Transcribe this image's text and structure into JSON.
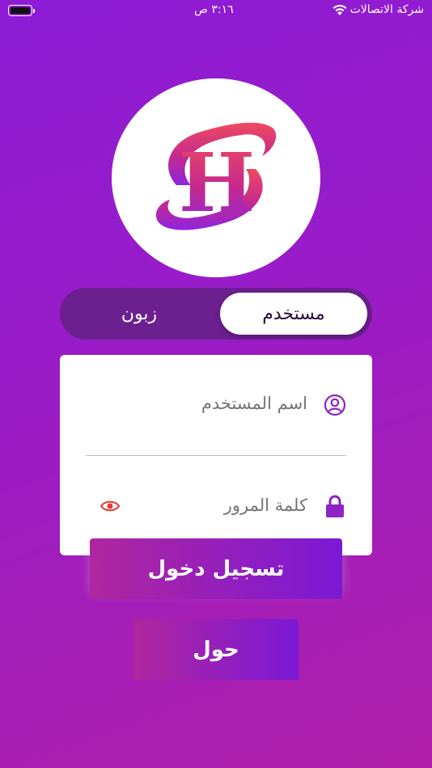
{
  "status_bar": {
    "carrier": "شركة الاتصالات",
    "time": "٣:١٦ ص"
  },
  "logo": {
    "letter_s": "S",
    "letter_h": "H"
  },
  "segment": {
    "active_label": "مستخدم",
    "inactive_label": "زبون"
  },
  "form": {
    "username_placeholder": "اسم المستخدم",
    "password_placeholder": "كلمة المرور"
  },
  "buttons": {
    "login_label": "تسجيل دخول",
    "about_label": "حول"
  },
  "colors": {
    "accent": "#8e24c4",
    "eye": "#e53935"
  },
  "icons": {
    "username": "user-circle-icon",
    "password": "lock-icon",
    "toggle_visibility": "eye-icon",
    "wifi": "wifi-icon",
    "battery": "battery-icon"
  }
}
